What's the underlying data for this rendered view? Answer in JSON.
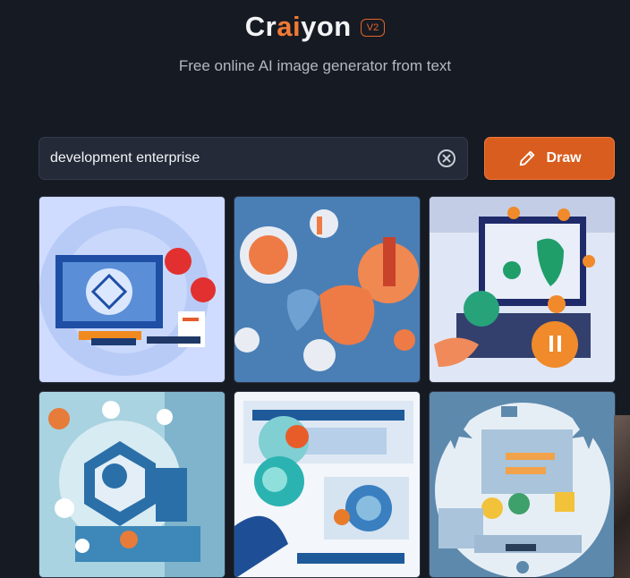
{
  "header": {
    "logo_prefix": "Cr",
    "logo_highlight": "ai",
    "logo_suffix": "yon",
    "version": "V2",
    "tagline": "Free online AI image generator from text"
  },
  "search": {
    "value": "development enterprise",
    "clear_icon": "close-circle-icon"
  },
  "draw_button": {
    "label": "Draw",
    "icon": "pencil-icon"
  },
  "colors": {
    "background": "#161a22",
    "accent": "#d95d1e",
    "input_bg": "#252a38"
  },
  "results": {
    "image_count": 6
  }
}
